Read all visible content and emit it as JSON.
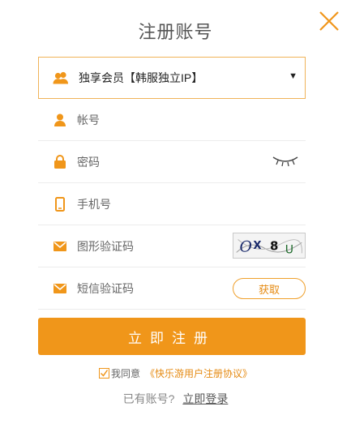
{
  "title": "注册账号",
  "colors": {
    "accent": "#f0961a",
    "accent_border": "#f0b359",
    "divider": "#ececec"
  },
  "member_select": {
    "icon": "users-icon",
    "selected": "独享会员【韩服独立IP】"
  },
  "fields": {
    "account": {
      "icon": "user-icon",
      "placeholder": "帐号"
    },
    "password": {
      "icon": "lock-icon",
      "placeholder": "密码",
      "toggle_icon": "eye-closed-icon"
    },
    "phone": {
      "icon": "phone-icon",
      "placeholder": "手机号"
    },
    "image_code": {
      "icon": "mail-icon",
      "placeholder": "图形验证码",
      "captcha_text": "OX8U"
    },
    "sms_code": {
      "icon": "mail-icon",
      "placeholder": "短信验证码",
      "get_label": "获取"
    }
  },
  "submit_label": "立即注册",
  "agreement": {
    "checked": true,
    "text": "我同意",
    "link": "《快乐游用户注册协议》"
  },
  "login": {
    "text": "已有账号?",
    "link": "立即登录"
  }
}
